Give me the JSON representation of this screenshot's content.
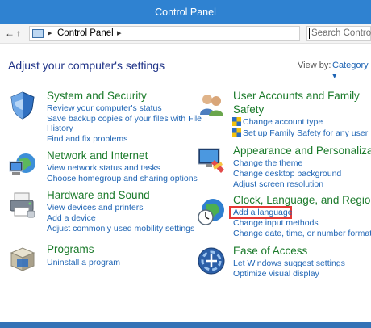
{
  "window": {
    "title": "Control Panel"
  },
  "nav": {
    "back_arrow": "←",
    "forward_arrow": "→",
    "up_arrow": "↑",
    "breadcrumb_sep_1": "▸",
    "breadcrumb": "Control Panel",
    "breadcrumb_sep_2": "▸",
    "search_placeholder": "Search Control Pa",
    "icons": [
      "control-panel-icon"
    ]
  },
  "page": {
    "heading": "Adjust your computer's settings",
    "view_by_label": "View by:",
    "view_by_value": "Category ▾"
  },
  "categories": {
    "system": {
      "icon": "shield-icon",
      "title": "System and Security",
      "links": [
        "Review your computer's status",
        "Save backup copies of your files with File",
        "History",
        "Find and fix problems"
      ]
    },
    "network": {
      "icon": "network-icon",
      "title": "Network and Internet",
      "links": [
        "View network status and tasks",
        "Choose homegroup and sharing options"
      ]
    },
    "hardware": {
      "icon": "printer-icon",
      "title": "Hardware and Sound",
      "links": [
        "View devices and printers",
        "Add a device",
        "Adjust commonly used mobility settings"
      ]
    },
    "programs": {
      "icon": "programs-icon",
      "title": "Programs",
      "links": [
        "Uninstall a program"
      ]
    },
    "users": {
      "icon": "users-icon",
      "title_line1": "User Accounts and Family",
      "title_line2": "Safety",
      "links": [
        "Change account type",
        "Set up Family Safety for any user"
      ]
    },
    "appearance": {
      "icon": "appearance-icon",
      "title": "Appearance and Personalization",
      "links": [
        "Change the theme",
        "Change desktop background",
        "Adjust screen resolution"
      ]
    },
    "clock": {
      "icon": "clock-globe-icon",
      "title": "Clock, Language, and Region",
      "links": [
        "Add a language",
        "Change input methods",
        "Change date, time, or number formats"
      ]
    },
    "ease": {
      "icon": "ease-of-access-icon",
      "title": "Ease of Access",
      "links": [
        "Let Windows suggest settings",
        "Optimize visual display"
      ]
    }
  },
  "colors": {
    "titlebar": "#2f82d1",
    "heading": "#1e3287",
    "category_title": "#1a7a2a",
    "link": "#1e64b4",
    "highlight": "#e53935"
  }
}
